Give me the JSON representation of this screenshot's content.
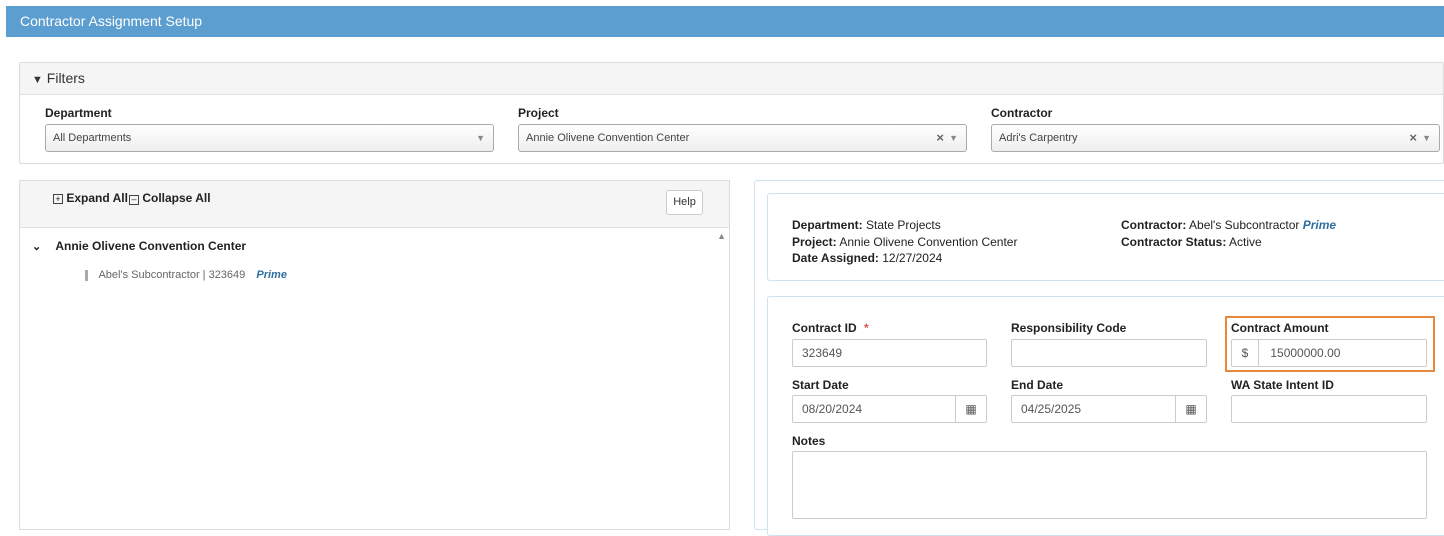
{
  "header": {
    "title": "Contractor Assignment Setup"
  },
  "filters": {
    "title": "Filters",
    "department": {
      "label": "Department",
      "value": "All Departments"
    },
    "project": {
      "label": "Project",
      "value": "Annie Olivene Convention Center"
    },
    "contractor": {
      "label": "Contractor",
      "value": "Adri's Carpentry"
    }
  },
  "tree": {
    "expand_all": "Expand All",
    "collapse_all": "Collapse All",
    "help": "Help",
    "root": {
      "label": "Annie Olivene Convention Center"
    },
    "child": {
      "label": "Abel's Subcontractor | 323649",
      "tag": "Prime"
    }
  },
  "info": {
    "department_label": "Department:",
    "department_value": "State Projects",
    "project_label": "Project:",
    "project_value": "Annie Olivene Convention Center",
    "date_label": "Date Assigned:",
    "date_value": "12/27/2024",
    "contractor_label": "Contractor:",
    "contractor_value": "Abel's Subcontractor",
    "contractor_tag": "Prime",
    "status_label": "Contractor Status:",
    "status_value": "Active"
  },
  "form": {
    "contract_id": {
      "label": "Contract ID",
      "required_mark": "*",
      "value": "323649"
    },
    "responsibility_code": {
      "label": "Responsibility Code",
      "value": ""
    },
    "contract_amount": {
      "label": "Contract Amount",
      "prefix": "$",
      "value": "15000000.00"
    },
    "start_date": {
      "label": "Start Date",
      "value": "08/20/2024"
    },
    "end_date": {
      "label": "End Date",
      "value": "04/25/2025"
    },
    "wa_intent_id": {
      "label": "WA State Intent ID",
      "value": ""
    },
    "notes": {
      "label": "Notes",
      "value": ""
    }
  }
}
